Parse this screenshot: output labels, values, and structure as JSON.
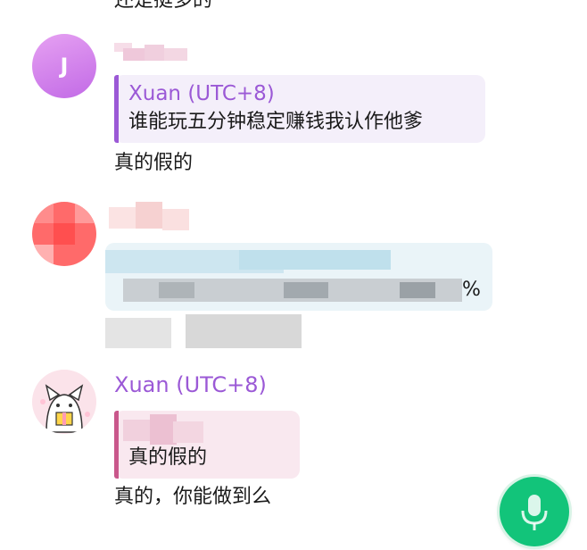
{
  "messages": [
    {
      "text": "还是挺多的"
    },
    {
      "avatar_letter": "J",
      "reply": {
        "author": "Xuan (UTC+8)",
        "quote": "谁能玩五分钟稳定赚钱我认作他爹"
      },
      "text": "真的假的"
    },
    {
      "obscured_tail": "%"
    },
    {
      "sender": "Xuan (UTC+8)",
      "reply": {
        "quote": "真的假的"
      },
      "text": "真的，你能做到么"
    }
  ],
  "composer": {
    "mic_icon": "microphone-icon"
  },
  "colors": {
    "accent_name": "#9b59d6",
    "reply_bar_purple": "#9b59d6",
    "reply_bg_purple": "#f4effa",
    "reply_bar_pink": "#c9578b",
    "reply_bg_pink": "#f9e8ef",
    "mic_green": "#12c47a"
  }
}
